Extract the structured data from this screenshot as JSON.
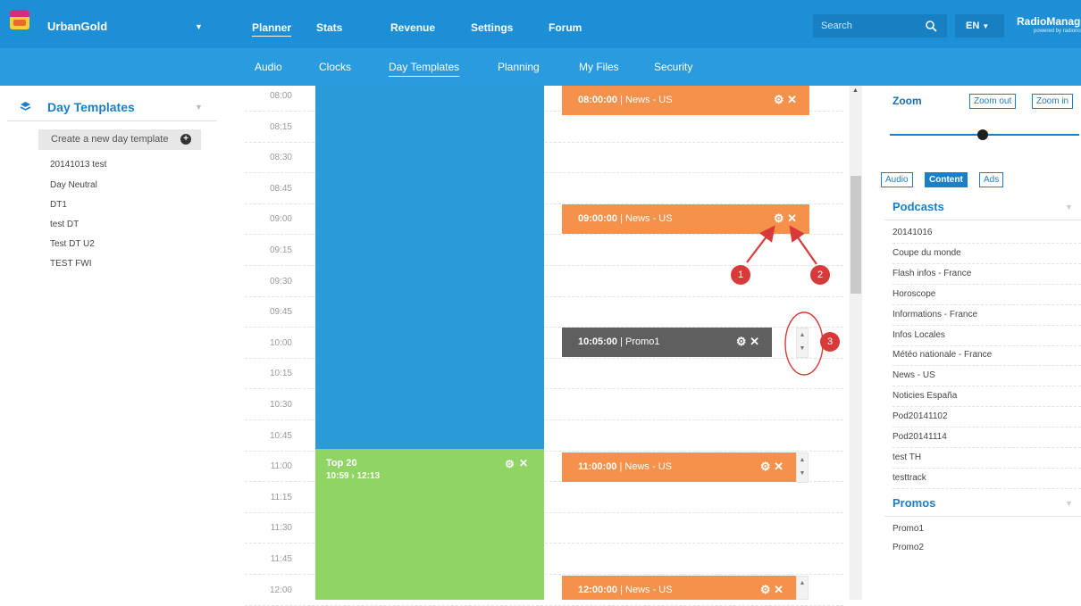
{
  "header": {
    "station": "UrbanGold",
    "nav": [
      "Planner",
      "Stats",
      "Revenue",
      "Settings",
      "Forum"
    ],
    "search_placeholder": "Search",
    "language": "EN",
    "brand": "RadioManage",
    "brand_sub": "powered by radiono"
  },
  "subnav": [
    "Audio",
    "Clocks",
    "Day Templates",
    "Planning",
    "My Files",
    "Security"
  ],
  "left_panel": {
    "title": "Day Templates",
    "create_button": "Create a new day template",
    "templates": [
      "20141013 test",
      "Day Neutral",
      "DT1",
      "test DT",
      "Test DT U2",
      "TEST FWI"
    ]
  },
  "timeline": {
    "times": [
      "08:00",
      "08:15",
      "08:30",
      "08:45",
      "09:00",
      "09:15",
      "09:30",
      "09:45",
      "10:00",
      "10:15",
      "10:30",
      "10:45",
      "11:00",
      "11:15",
      "11:30",
      "11:45",
      "12:00"
    ],
    "green_block": {
      "title": "Top 20",
      "range": "10:59 › 12:13"
    },
    "events": [
      {
        "time": "08:00:00",
        "name": "News - US"
      },
      {
        "time": "09:00:00",
        "name": "News - US"
      },
      {
        "time": "10:05:00",
        "name": "Promo1"
      },
      {
        "time": "11:00:00",
        "name": "News - US"
      },
      {
        "time": "12:00:00",
        "name": "News - US"
      }
    ],
    "separator": " | "
  },
  "annotations": [
    "1",
    "2",
    "3"
  ],
  "right_panel": {
    "zoom_label": "Zoom",
    "zoom_out": "Zoom out",
    "zoom_in": "Zoom in",
    "filters": [
      "Audio",
      "Content",
      "Ads"
    ],
    "active_filter": "Content",
    "podcasts_title": "Podcasts",
    "podcasts": [
      "20141016",
      "Coupe du monde",
      "Flash infos - France",
      "Horoscope",
      "Informations - France",
      "Infos Locales",
      "Météo nationale - France",
      "News - US",
      "Noticies España",
      "Pod20141102",
      "Pod20141114",
      "test TH",
      "testtrack"
    ],
    "promos_title": "Promos",
    "promos": [
      "Promo1",
      "Promo2"
    ]
  },
  "colors": {
    "topbar": "#1d8fd6",
    "subbar": "#2a9bdf",
    "event_orange": "#f5914b",
    "event_gray": "#5f5f5f",
    "block_blue": "#2a9ad8",
    "block_green": "#8fd465",
    "annotation_red": "#d83a3a"
  }
}
